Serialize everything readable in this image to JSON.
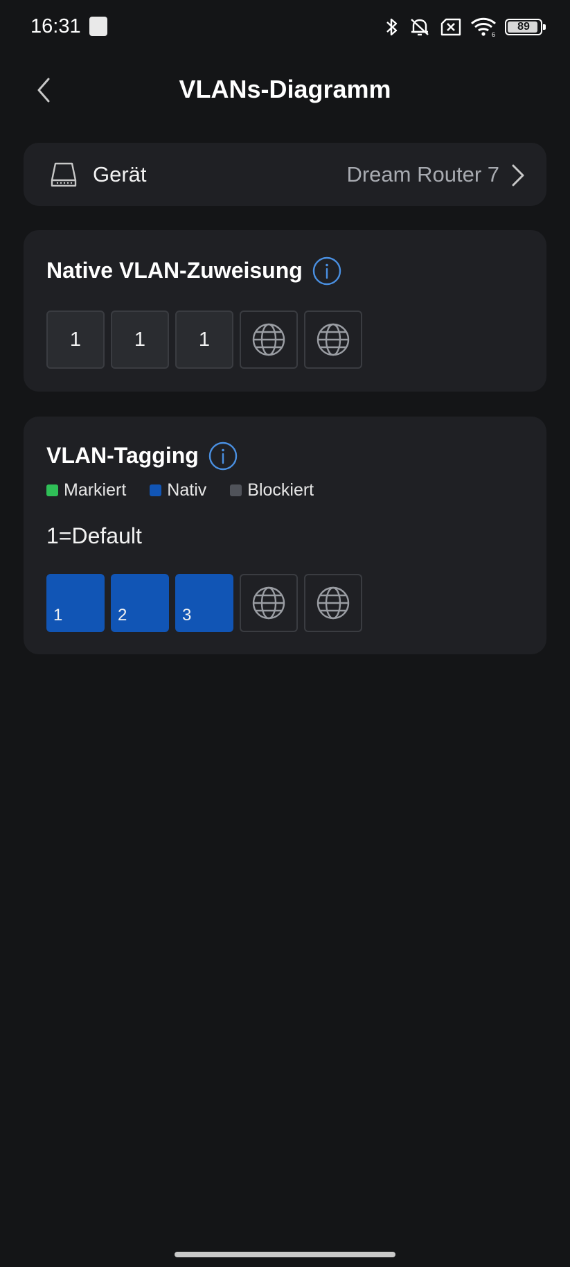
{
  "status_bar": {
    "time": "16:31",
    "battery": "89",
    "icons": [
      "notification-square-icon",
      "bluetooth-icon",
      "mute-icon",
      "no-sim-icon",
      "wifi-icon",
      "battery-icon"
    ]
  },
  "header": {
    "title": "VLANs-Diagramm",
    "back_icon": "chevron-left-icon"
  },
  "device": {
    "label": "Gerät",
    "value": "Dream Router 7",
    "icon": "router-icon",
    "chevron": "chevron-right-icon"
  },
  "native_vlan": {
    "title": "Native VLAN-Zuweisung",
    "info_icon": "info-icon",
    "ports": [
      {
        "label": "1",
        "type": "number"
      },
      {
        "label": "1",
        "type": "number"
      },
      {
        "label": "1",
        "type": "number"
      },
      {
        "label": "",
        "type": "globe"
      },
      {
        "label": "",
        "type": "globe"
      }
    ]
  },
  "vlan_tagging": {
    "title": "VLAN-Tagging",
    "info_icon": "info-icon",
    "legend": [
      {
        "label": "Markiert",
        "color": "#2fbf57"
      },
      {
        "label": "Nativ",
        "color": "#1155b5"
      },
      {
        "label": "Blockiert",
        "color": "#50535a"
      }
    ],
    "default_text": "1=Default",
    "ports": [
      {
        "label": "1",
        "type": "native"
      },
      {
        "label": "2",
        "type": "native"
      },
      {
        "label": "3",
        "type": "native"
      },
      {
        "label": "",
        "type": "globe"
      },
      {
        "label": "",
        "type": "globe"
      }
    ]
  },
  "colors": {
    "background": "#141517",
    "card": "#1f2024",
    "accent_blue": "#4a90e2",
    "native_blue": "#1155b5"
  }
}
